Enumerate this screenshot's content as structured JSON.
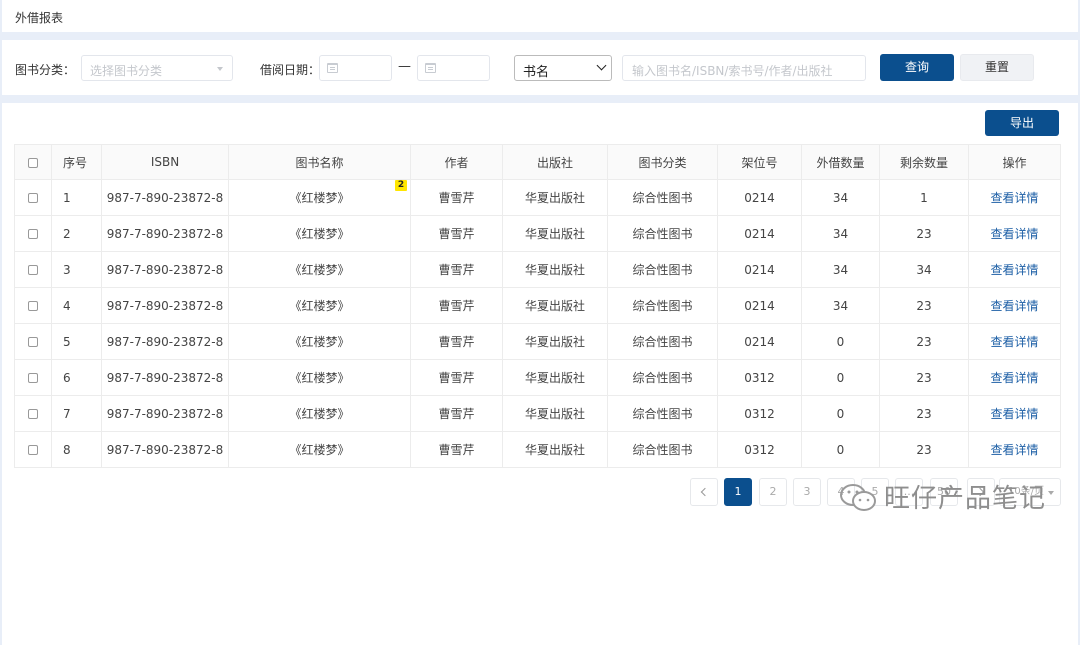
{
  "header": {
    "title": "外借报表"
  },
  "filters": {
    "category_label": "图书分类：",
    "category_placeholder": "选择图书分类",
    "date_label": "借阅日期：",
    "date_separator": "—",
    "field_select_value": "书名",
    "search_placeholder": "输入图书名/ISBN/索书号/作者/出版社",
    "query_button": "查询",
    "reset_button": "重置"
  },
  "toolbar": {
    "export_button": "导出"
  },
  "table": {
    "columns": [
      "序号",
      "ISBN",
      "图书名称",
      "作者",
      "出版社",
      "图书分类",
      "架位号",
      "外借数量",
      "剩余数量",
      "操作"
    ],
    "title_badge": "2",
    "rows": [
      {
        "no": "1",
        "isbn": "987-7-890-23872-8",
        "title": "《红楼梦》",
        "author": "曹雪芹",
        "publisher": "华夏出版社",
        "category": "综合性图书",
        "shelf": "0214",
        "lent": "34",
        "remaining": "1",
        "action": "查看详情"
      },
      {
        "no": "2",
        "isbn": "987-7-890-23872-8",
        "title": "《红楼梦》",
        "author": "曹雪芹",
        "publisher": "华夏出版社",
        "category": "综合性图书",
        "shelf": "0214",
        "lent": "34",
        "remaining": "23",
        "action": "查看详情"
      },
      {
        "no": "3",
        "isbn": "987-7-890-23872-8",
        "title": "《红楼梦》",
        "author": "曹雪芹",
        "publisher": "华夏出版社",
        "category": "综合性图书",
        "shelf": "0214",
        "lent": "34",
        "remaining": "34",
        "action": "查看详情"
      },
      {
        "no": "4",
        "isbn": "987-7-890-23872-8",
        "title": "《红楼梦》",
        "author": "曹雪芹",
        "publisher": "华夏出版社",
        "category": "综合性图书",
        "shelf": "0214",
        "lent": "34",
        "remaining": "23",
        "action": "查看详情"
      },
      {
        "no": "5",
        "isbn": "987-7-890-23872-8",
        "title": "《红楼梦》",
        "author": "曹雪芹",
        "publisher": "华夏出版社",
        "category": "综合性图书",
        "shelf": "0214",
        "lent": "0",
        "remaining": "23",
        "action": "查看详情"
      },
      {
        "no": "6",
        "isbn": "987-7-890-23872-8",
        "title": "《红楼梦》",
        "author": "曹雪芹",
        "publisher": "华夏出版社",
        "category": "综合性图书",
        "shelf": "0312",
        "lent": "0",
        "remaining": "23",
        "action": "查看详情"
      },
      {
        "no": "7",
        "isbn": "987-7-890-23872-8",
        "title": "《红楼梦》",
        "author": "曹雪芹",
        "publisher": "华夏出版社",
        "category": "综合性图书",
        "shelf": "0312",
        "lent": "0",
        "remaining": "23",
        "action": "查看详情"
      },
      {
        "no": "8",
        "isbn": "987-7-890-23872-8",
        "title": "《红楼梦》",
        "author": "曹雪芹",
        "publisher": "华夏出版社",
        "category": "综合性图书",
        "shelf": "0312",
        "lent": "0",
        "remaining": "23",
        "action": "查看详情"
      }
    ]
  },
  "pagination": {
    "pages": [
      "1",
      "2",
      "3",
      "4",
      "5",
      "...",
      "50"
    ],
    "active_page": "1",
    "page_size": "10条/页"
  },
  "watermark": {
    "text": "旺仔产品笔记"
  },
  "colors": {
    "primary": "#0b4f8e",
    "link": "#1d5fa6",
    "background": "#e8eef8",
    "badge": "#ffe600"
  },
  "icons": [
    "caret-down-icon",
    "calendar-icon",
    "chevron-down-icon",
    "chevron-left-icon",
    "chevron-right-icon",
    "wechat-icon"
  ]
}
